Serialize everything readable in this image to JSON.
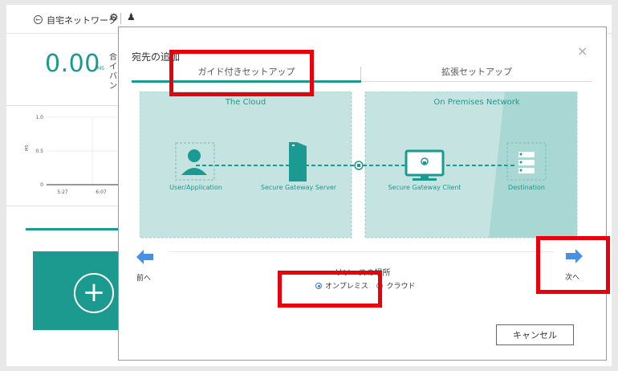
{
  "app": {
    "breadcrumb": "自宅ネットワーク",
    "metric_value": "0.00",
    "metric_unit": "MS",
    "side_text": [
      "合",
      "イ",
      "バ",
      "ン"
    ],
    "mini_chart": {
      "type": "line",
      "ylabel": "MS",
      "y_ticks": [
        "1.0",
        "0.5",
        "0"
      ],
      "x_ticks": [
        "5:27",
        "6:07"
      ]
    }
  },
  "dialog": {
    "title": "宛先の追加",
    "close_label": "×",
    "tabs": [
      {
        "label": "ガイド付きセットアップ",
        "active": true
      },
      {
        "label": "拡張セットアップ",
        "active": false
      }
    ],
    "diagram": {
      "cloud_title": "The Cloud",
      "premises_title": "On Premises Network",
      "nodes": [
        {
          "label": "User/Application",
          "icon": "user-icon"
        },
        {
          "label": "Secure Gateway Server",
          "icon": "server-tower-icon"
        },
        {
          "label": "Secure Gateway Client",
          "icon": "monitor-lock-icon"
        },
        {
          "label": "Destination",
          "icon": "server-stack-icon"
        }
      ]
    },
    "prev_label": "前へ",
    "next_label": "次へ",
    "resource_location_label": "リソースの場所",
    "resource_options": [
      {
        "label": "オンプレミス",
        "selected": true
      },
      {
        "label": "クラウド",
        "selected": false
      }
    ],
    "cancel_label": "キャンセル"
  },
  "colors": {
    "accent": "#1a9a90",
    "diagram_bg": "#c5e3e1",
    "highlight": "#e8000b",
    "arrow": "#4a90e2"
  }
}
